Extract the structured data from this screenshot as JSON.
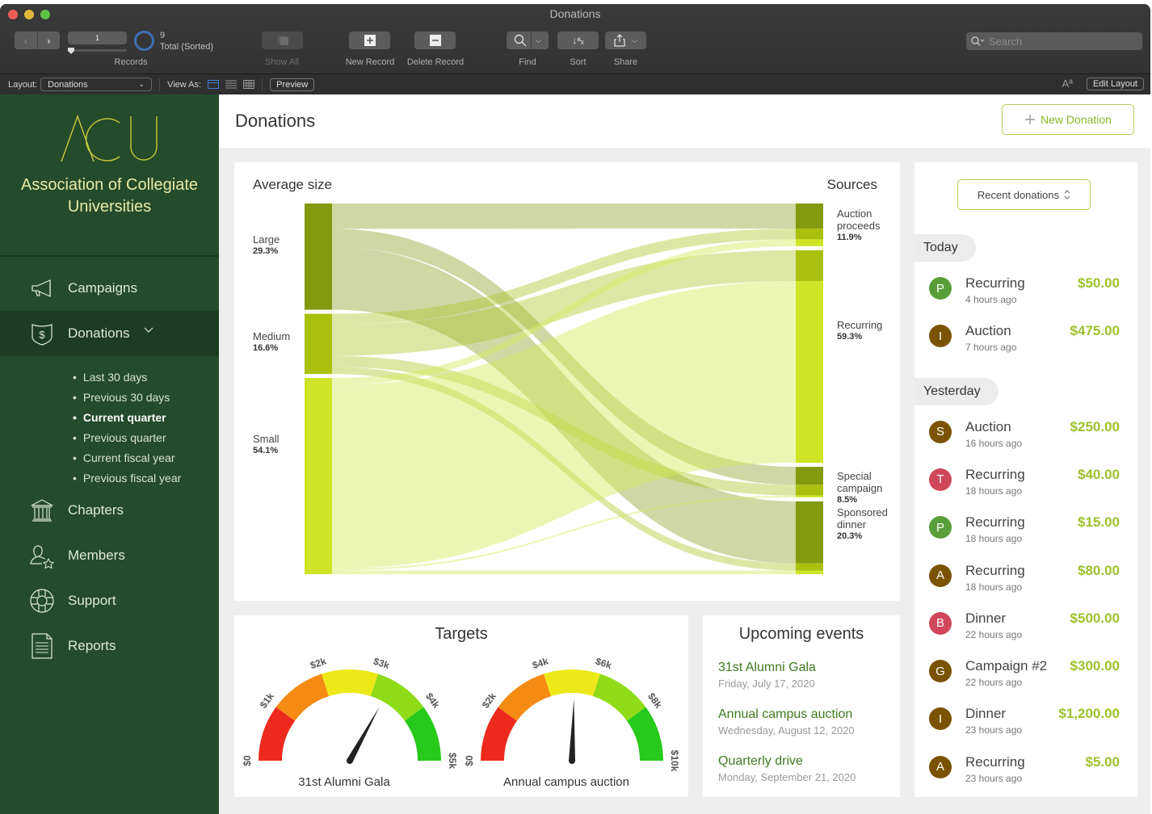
{
  "window": {
    "title": "Donations"
  },
  "toolbar": {
    "record_current": "1",
    "record_count": "9",
    "record_status": "Total (Sorted)",
    "records_label": "Records",
    "show_all_label": "Show All",
    "new_record_label": "New Record",
    "delete_record_label": "Delete Record",
    "find_label": "Find",
    "sort_label": "Sort",
    "share_label": "Share",
    "search_placeholder": "Search"
  },
  "layoutbar": {
    "layout_label": "Layout:",
    "layout_value": "Donations",
    "view_as_label": "View As:",
    "preview_label": "Preview",
    "text_size_glyph": "Aª",
    "edit_layout_label": "Edit Layout"
  },
  "sidebar": {
    "logo_text": "ACU",
    "org_name": "Association of Collegiate Universities",
    "items": [
      {
        "label": "Campaigns",
        "icon": "megaphone-icon"
      },
      {
        "label": "Donations",
        "icon": "shield-dollar-icon",
        "active": true
      },
      {
        "label": "Chapters",
        "icon": "building-columns-icon"
      },
      {
        "label": "Members",
        "icon": "member-star-icon"
      },
      {
        "label": "Support",
        "icon": "lifebuoy-icon"
      },
      {
        "label": "Reports",
        "icon": "document-icon"
      }
    ],
    "subitems": [
      {
        "label": "Last 30 days"
      },
      {
        "label": "Previous 30 days"
      },
      {
        "label": "Current quarter",
        "current": true
      },
      {
        "label": "Previous quarter"
      },
      {
        "label": "Current fiscal year"
      },
      {
        "label": "Previous fiscal year"
      }
    ]
  },
  "main": {
    "title": "Donations",
    "new_donation_label": "New Donation"
  },
  "colors": {
    "sidebar_bg": "#244c2b",
    "accent_green": "#9dc12c",
    "event_green": "#3f7a1e"
  },
  "chart_data": [
    {
      "type": "sankey",
      "title_left": "Average size",
      "title_right": "Sources",
      "left_nodes": [
        {
          "name": "Large",
          "percent": "29.3%",
          "value": 29.3,
          "color": "#849a0e"
        },
        {
          "name": "Medium",
          "percent": "16.6%",
          "value": 16.6,
          "color": "#a9c10c"
        },
        {
          "name": "Small",
          "percent": "54.1%",
          "value": 54.1,
          "color": "#cde526"
        }
      ],
      "right_nodes": [
        {
          "name": "Auction proceeds",
          "percent": "11.9%",
          "value": 11.9
        },
        {
          "name": "Recurring",
          "percent": "59.3%",
          "value": 59.3
        },
        {
          "name": "Special campaign",
          "percent": "8.5%",
          "value": 8.5
        },
        {
          "name": "Sponsored dinner",
          "percent": "20.3%",
          "value": 20.3
        }
      ],
      "flows": [
        {
          "from": "Large",
          "to": "Auction proceeds",
          "value": 7.0
        },
        {
          "from": "Large",
          "to": "Special campaign",
          "value": 5.0
        },
        {
          "from": "Large",
          "to": "Sponsored dinner",
          "value": 17.3
        },
        {
          "from": "Medium",
          "to": "Auction proceeds",
          "value": 3.0
        },
        {
          "from": "Medium",
          "to": "Recurring",
          "value": 8.6
        },
        {
          "from": "Medium",
          "to": "Special campaign",
          "value": 3.0
        },
        {
          "from": "Medium",
          "to": "Sponsored dinner",
          "value": 2.0
        },
        {
          "from": "Small",
          "to": "Auction proceeds",
          "value": 1.9
        },
        {
          "from": "Small",
          "to": "Recurring",
          "value": 50.7
        },
        {
          "from": "Small",
          "to": "Special campaign",
          "value": 0.5
        },
        {
          "from": "Small",
          "to": "Sponsored dinner",
          "value": 1.0
        }
      ]
    },
    {
      "type": "gauge",
      "title": "Targets",
      "label": "31st Alumni Gala",
      "min": 0,
      "max": 5000,
      "ticks": [
        "$0",
        "$1k",
        "$2k",
        "$3k",
        "$4k",
        "$5k"
      ],
      "value": 3300,
      "bands": [
        "#ee2a1f",
        "#f58b12",
        "#ede817",
        "#8fdb17",
        "#27c91a"
      ]
    },
    {
      "type": "gauge",
      "label": "Annual campus auction",
      "min": 0,
      "max": 10000,
      "ticks": [
        "$0",
        "$2k",
        "$4k",
        "$6k",
        "$8k",
        "$10k"
      ],
      "value": 5100,
      "bands": [
        "#ee2a1f",
        "#f58b12",
        "#ede817",
        "#8fdb17",
        "#27c91a"
      ]
    }
  ],
  "targets": {
    "title": "Targets"
  },
  "events": {
    "title": "Upcoming events",
    "items": [
      {
        "name": "31st Alumni Gala",
        "date": "Friday, July 17, 2020"
      },
      {
        "name": "Annual campus auction",
        "date": "Wednesday, August 12, 2020"
      },
      {
        "name": "Quarterly drive",
        "date": "Monday, September 21, 2020"
      }
    ]
  },
  "recent": {
    "selector_label": "Recent donations",
    "groups": [
      {
        "label": "Today",
        "items": [
          {
            "initial": "P",
            "color": "#5a9e3a",
            "kind": "Recurring",
            "ago": "4 hours ago",
            "amount": "$50.00"
          },
          {
            "initial": "I",
            "color": "#7a5200",
            "kind": "Auction",
            "ago": "7 hours ago",
            "amount": "$475.00"
          }
        ]
      },
      {
        "label": "Yesterday",
        "items": [
          {
            "initial": "S",
            "color": "#7a5200",
            "kind": "Auction",
            "ago": "16 hours ago",
            "amount": "$250.00"
          },
          {
            "initial": "T",
            "color": "#d0475a",
            "kind": "Recurring",
            "ago": "18 hours ago",
            "amount": "$40.00"
          },
          {
            "initial": "P",
            "color": "#5a9e3a",
            "kind": "Recurring",
            "ago": "18 hours ago",
            "amount": "$15.00"
          },
          {
            "initial": "A",
            "color": "#7a5200",
            "kind": "Recurring",
            "ago": "18 hours ago",
            "amount": "$80.00"
          },
          {
            "initial": "B",
            "color": "#d0475a",
            "kind": "Dinner",
            "ago": "22 hours ago",
            "amount": "$500.00"
          },
          {
            "initial": "G",
            "color": "#7a5200",
            "kind": "Campaign #2",
            "ago": "22 hours ago",
            "amount": "$300.00"
          },
          {
            "initial": "I",
            "color": "#7a5200",
            "kind": "Dinner",
            "ago": "23 hours ago",
            "amount": "$1,200.00"
          },
          {
            "initial": "A",
            "color": "#7a5200",
            "kind": "Recurring",
            "ago": "23 hours ago",
            "amount": "$5.00"
          }
        ]
      }
    ]
  }
}
